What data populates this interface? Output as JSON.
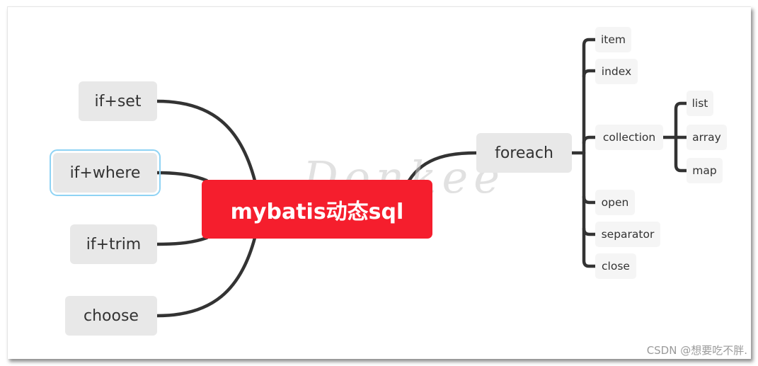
{
  "root": {
    "label": "mybatis动态sql",
    "color": "#f51e2d"
  },
  "left_branches": [
    {
      "label": "if+set"
    },
    {
      "label": "if+where",
      "selected": true
    },
    {
      "label": "if+trim"
    },
    {
      "label": "choose"
    }
  ],
  "right_branch": {
    "label": "foreach",
    "children": [
      {
        "label": "item"
      },
      {
        "label": "index"
      },
      {
        "label": "collection",
        "children": [
          {
            "label": "list"
          },
          {
            "label": "array"
          },
          {
            "label": "map"
          }
        ]
      },
      {
        "label": "open"
      },
      {
        "label": "separator"
      },
      {
        "label": "close"
      }
    ]
  },
  "watermark": "Donkee",
  "credit": "CSDN @想要吃不胖."
}
